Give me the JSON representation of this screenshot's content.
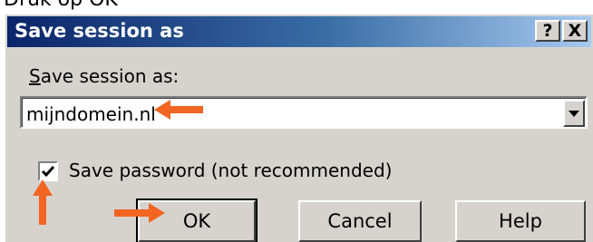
{
  "caption": "Druk op OK",
  "dialog": {
    "title": "Save session as",
    "help_button": "?",
    "close_button": "X"
  },
  "form": {
    "label": "Save session as:",
    "label_mnemonic": "S",
    "label_rest": "ave session as:",
    "value": "mijndomein.nl",
    "save_password_label": "Save password (not recommended)",
    "save_password_checked": true
  },
  "buttons": {
    "ok": "OK",
    "cancel": "Cancel",
    "help": "Help"
  },
  "colors": {
    "annotation_arrow": "#f26522",
    "title_bar_start": "#0a246a",
    "face": "#d6d3ce"
  },
  "icons": [
    "dropdown-arrow-icon",
    "checkmark-icon",
    "annotation-arrow-icon"
  ]
}
